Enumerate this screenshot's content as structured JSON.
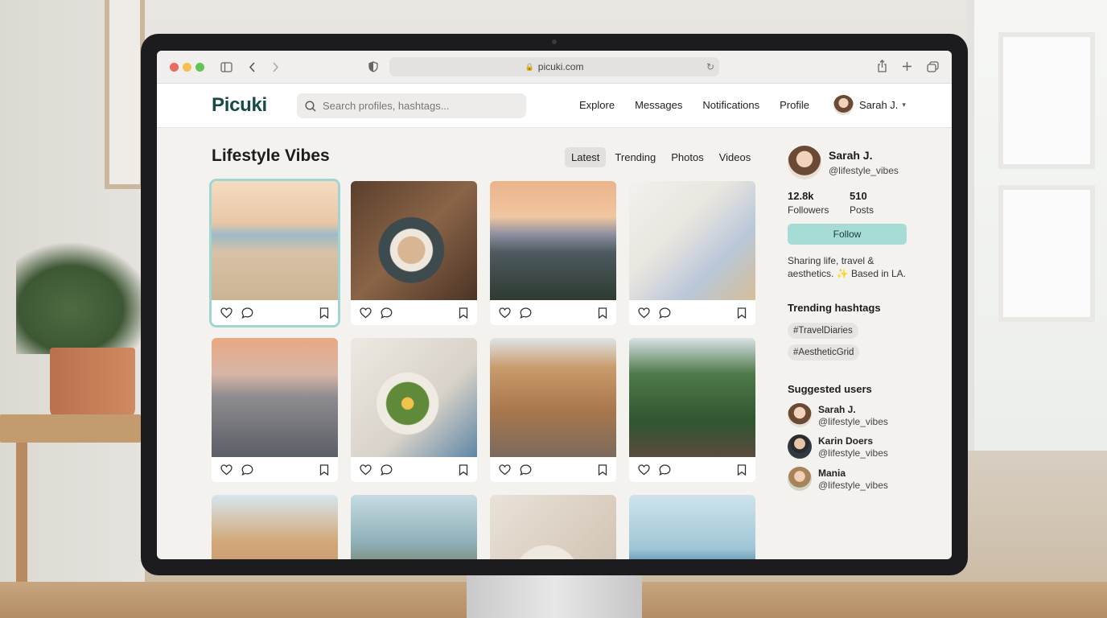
{
  "browser": {
    "url": "picuki.com"
  },
  "app": {
    "logo": "Picuki",
    "search_placeholder": "Search profiles, hashtags...",
    "nav": [
      "Explore",
      "Messages",
      "Notifications",
      "Profile"
    ],
    "user_name": "Sarah J.",
    "accent_color": "#a7dcd6",
    "brand_color": "#154a45"
  },
  "main": {
    "title": "Lifestyle Vibes",
    "tabs": [
      {
        "label": "Latest",
        "active": true
      },
      {
        "label": "Trending",
        "active": false
      },
      {
        "label": "Photos",
        "active": false
      },
      {
        "label": "Videos",
        "active": false
      }
    ],
    "posts": [
      {
        "subject": "woman-on-beach-photo",
        "selected": true
      },
      {
        "subject": "latte-art-coffee-photo",
        "selected": false
      },
      {
        "subject": "mountain-sunset-photo",
        "selected": false
      },
      {
        "subject": "outfit-flatlay-photo",
        "selected": false
      },
      {
        "subject": "city-skyline-photo",
        "selected": false
      },
      {
        "subject": "salad-egg-plate-photo",
        "selected": false
      },
      {
        "subject": "european-street-photo",
        "selected": false
      },
      {
        "subject": "jungle-balcony-photo",
        "selected": false
      },
      {
        "subject": "old-town-buildings-photo",
        "selected": false
      },
      {
        "subject": "coast-hat-woman-photo",
        "selected": false
      },
      {
        "subject": "grain-bowl-photo",
        "selected": false
      },
      {
        "subject": "sea-woman-back-photo",
        "selected": false
      }
    ]
  },
  "sidebar": {
    "profile": {
      "name": "Sarah J.",
      "handle": "@lifestyle_vibes",
      "followers_count": "12.8k",
      "followers_label": "Followers",
      "posts_count": "510",
      "posts_label": "Posts",
      "follow_label": "Follow",
      "bio": "Sharing life, travel & aesthetics. ✨ Based in LA."
    },
    "trending_title": "Trending hashtags",
    "hashtags": [
      "#TravelDiaries",
      "#AestheticGrid"
    ],
    "suggested_title": "Suggested users",
    "suggested": [
      {
        "name": "Sarah J.",
        "handle": "@lifestyle_vibes"
      },
      {
        "name": "Karin Doers",
        "handle": "@lifestyle_vibes"
      },
      {
        "name": "Mania",
        "handle": "@lifestyle_vibes"
      }
    ]
  }
}
